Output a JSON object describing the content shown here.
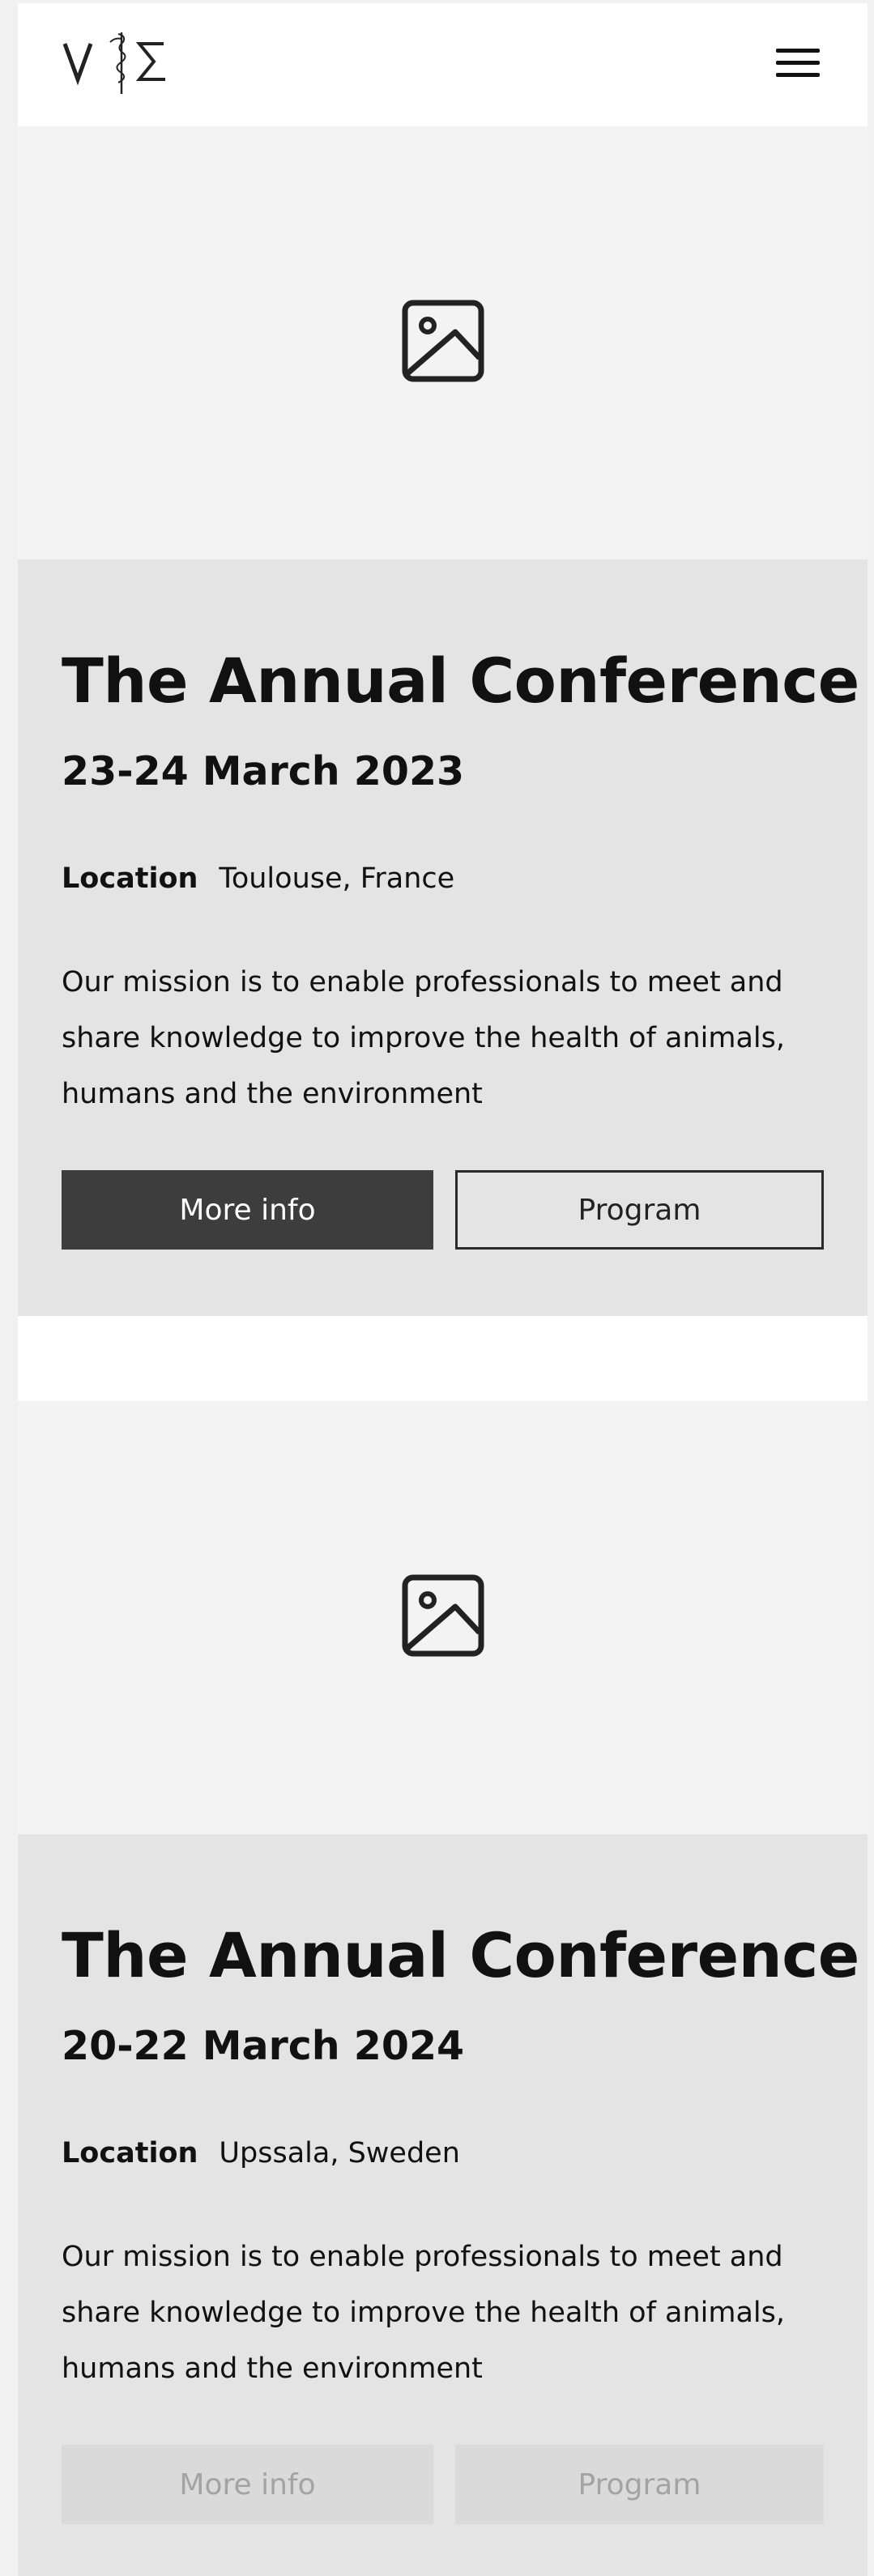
{
  "header": {
    "logo_alt": "VIE logo",
    "logo_icon": "logo-icon",
    "menu_icon": "hamburger-menu-icon"
  },
  "events": [
    {
      "image_icon": "image-placeholder-icon",
      "title": "The Annual Conference",
      "date": "23-24 March 2023",
      "location_label": "Location",
      "location_value": "Toulouse, France",
      "description": "Our mission is to enable professionals to meet and share knowledge to improve the health of animals, humans and the environment",
      "more_info_label": "More info",
      "program_label": "Program",
      "buttons_enabled": true
    },
    {
      "image_icon": "image-placeholder-icon",
      "title": "The Annual Conference",
      "date": "20-22 March 2024",
      "location_label": "Location",
      "location_value": "Upssala, Sweden",
      "description": "Our mission is to enable professionals to meet and share knowledge to improve the health of animals, humans and the environment",
      "more_info_label": "More info",
      "program_label": "Program",
      "buttons_enabled": false
    }
  ],
  "colors": {
    "header_bg": "#ffffff",
    "media_bg": "#f3f3f3",
    "content_bg": "#e4e4e4",
    "primary_button_bg": "#3d3d3d",
    "disabled_button_bg": "#dadada",
    "disabled_text": "#a3a3a3",
    "text": "#111111"
  }
}
